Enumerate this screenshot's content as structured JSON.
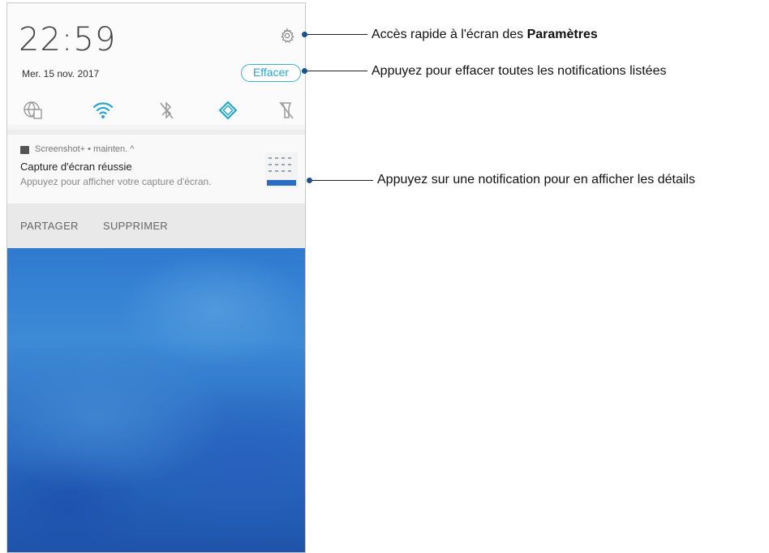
{
  "status": {
    "time": "22:59",
    "date": "Mer. 15 nov. 2017"
  },
  "header": {
    "clear_label": "Effacer"
  },
  "quick_settings": [
    {
      "name": "network-globe-icon",
      "active": false
    },
    {
      "name": "wifi-icon",
      "active": true
    },
    {
      "name": "bluetooth-off-icon",
      "active": false
    },
    {
      "name": "auto-rotate-icon",
      "active": true
    },
    {
      "name": "flashlight-off-icon",
      "active": false
    }
  ],
  "notification": {
    "app_line": "Screenshot+ • mainten. ^",
    "title": "Capture d'écran réussie",
    "body": "Appuyez pour afficher votre capture d'écran.",
    "actions": [
      "PARTAGER",
      "SUPPRIMER"
    ]
  },
  "callouts": {
    "settings_prefix": "Accès rapide à l'écran des ",
    "settings_bold": "Paramètres",
    "clear": "Appuyez pour effacer toutes les notifications listées",
    "notification": "Appuyez sur une notification pour en afficher les détails"
  },
  "colors": {
    "accent": "#2ba7c6",
    "callout_dot": "#1d4f8c",
    "wallpaper": "#2f7ad0"
  }
}
